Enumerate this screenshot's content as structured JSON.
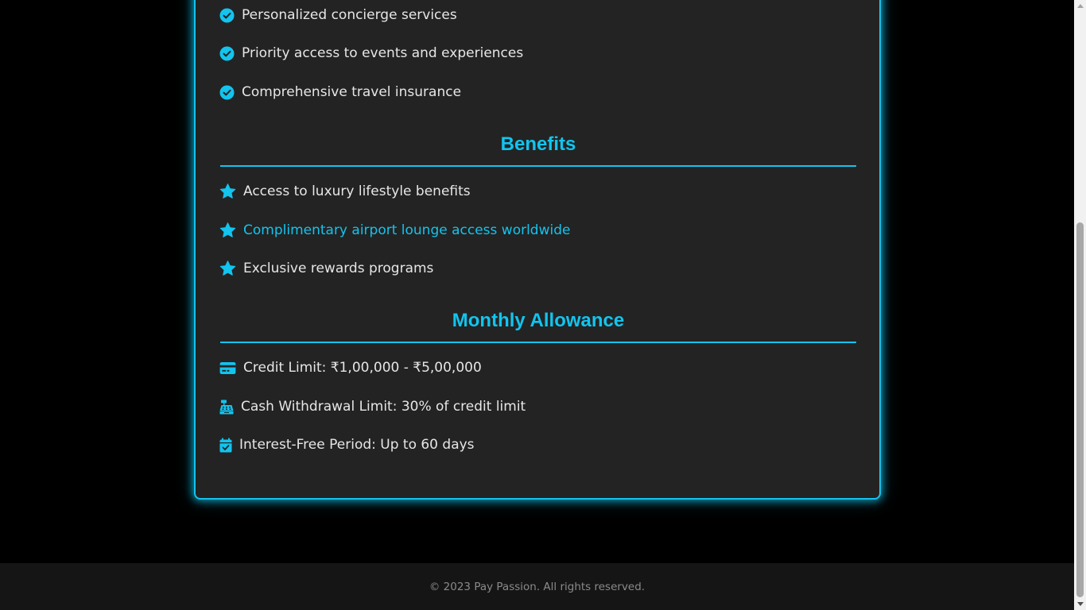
{
  "features": {
    "items": [
      {
        "label": "Personalized concierge services",
        "icon": "check-circle-icon"
      },
      {
        "label": "Priority access to events and experiences",
        "icon": "check-circle-icon"
      },
      {
        "label": "Comprehensive travel insurance",
        "icon": "check-circle-icon"
      }
    ]
  },
  "benefits": {
    "title": "Benefits",
    "items": [
      {
        "label": "Access to luxury lifestyle benefits",
        "icon": "star-icon"
      },
      {
        "label": "Complimentary airport lounge access worldwide",
        "icon": "star-icon",
        "highlighted": true
      },
      {
        "label": "Exclusive rewards programs",
        "icon": "star-icon"
      }
    ]
  },
  "allowance": {
    "title": "Monthly Allowance",
    "items": [
      {
        "label": "Credit Limit: ₹1,00,000 - ₹5,00,000",
        "icon": "credit-card-icon"
      },
      {
        "label": "Cash Withdrawal Limit: 30% of credit limit",
        "icon": "cash-register-icon"
      },
      {
        "label": "Interest-Free Period: Up to 60 days",
        "icon": "calendar-check-icon"
      }
    ]
  },
  "footer": {
    "text": "© 2023 Pay Passion. All rights reserved."
  },
  "colors": {
    "accent": "#12c4ee",
    "background": "#000000",
    "card": "#232323",
    "footer": "#151515"
  }
}
